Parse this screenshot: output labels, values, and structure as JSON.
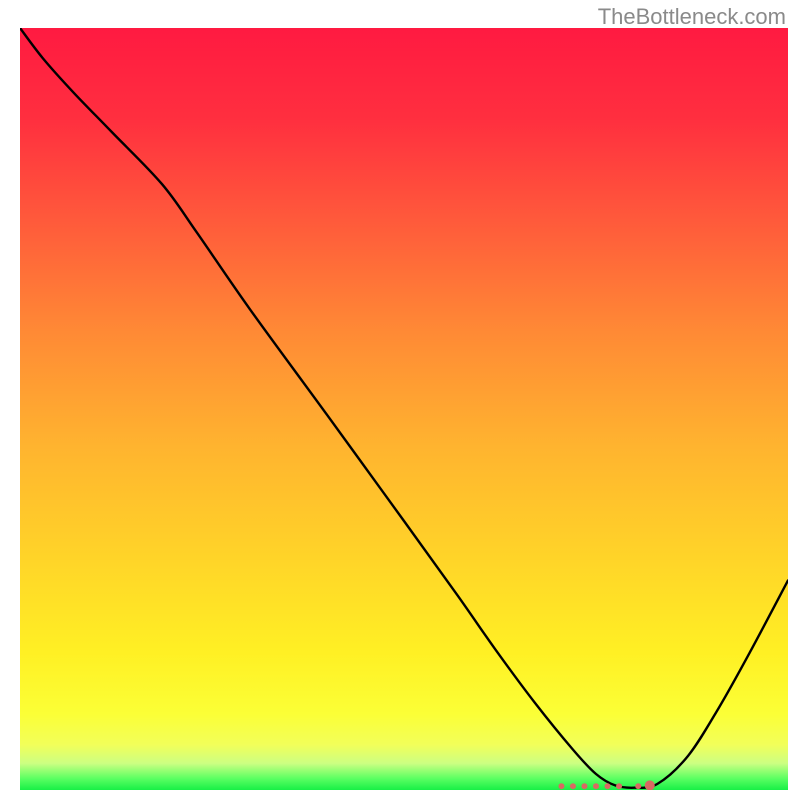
{
  "watermark": "TheBottleneck.com",
  "chart_data": {
    "type": "line",
    "title": "",
    "xlabel": "",
    "ylabel": "",
    "xlim": [
      0,
      100
    ],
    "ylim": [
      0,
      100
    ],
    "gradient": {
      "stops": [
        {
          "offset": 0.0,
          "color": "#ff1a41"
        },
        {
          "offset": 0.12,
          "color": "#ff2f3f"
        },
        {
          "offset": 0.25,
          "color": "#ff593b"
        },
        {
          "offset": 0.4,
          "color": "#ff8a35"
        },
        {
          "offset": 0.55,
          "color": "#ffb42f"
        },
        {
          "offset": 0.7,
          "color": "#ffd528"
        },
        {
          "offset": 0.82,
          "color": "#fff024"
        },
        {
          "offset": 0.9,
          "color": "#fbff36"
        },
        {
          "offset": 0.94,
          "color": "#f2ff59"
        },
        {
          "offset": 0.965,
          "color": "#ccff82"
        },
        {
          "offset": 0.985,
          "color": "#5aff62"
        },
        {
          "offset": 1.0,
          "color": "#18f046"
        }
      ]
    },
    "series": [
      {
        "name": "bottleneck-curve",
        "color": "#000000",
        "x": [
          0.0,
          3.0,
          7.0,
          12.0,
          18.5,
          23.0,
          30.0,
          40.0,
          50.0,
          57.0,
          62.0,
          67.0,
          72.0,
          75.0,
          77.5,
          80.0,
          83.0,
          87.0,
          91.0,
          95.0,
          100.0
        ],
        "y": [
          100.0,
          96.0,
          91.5,
          86.3,
          79.5,
          73.2,
          63.0,
          49.2,
          35.3,
          25.5,
          18.3,
          11.5,
          5.3,
          2.1,
          0.6,
          0.3,
          0.8,
          4.5,
          10.8,
          18.0,
          27.5
        ]
      }
    ],
    "markers": {
      "name": "min-band",
      "color": "#d86a62",
      "points": [
        {
          "x": 70.5,
          "y": 0.5
        },
        {
          "x": 72.0,
          "y": 0.5
        },
        {
          "x": 73.5,
          "y": 0.5
        },
        {
          "x": 75.0,
          "y": 0.5
        },
        {
          "x": 76.5,
          "y": 0.5
        },
        {
          "x": 78.0,
          "y": 0.5
        },
        {
          "x": 80.5,
          "y": 0.5
        },
        {
          "x": 82.0,
          "y": 0.6
        }
      ],
      "radius": [
        3,
        3,
        3,
        3,
        3,
        3,
        3,
        5
      ]
    }
  }
}
